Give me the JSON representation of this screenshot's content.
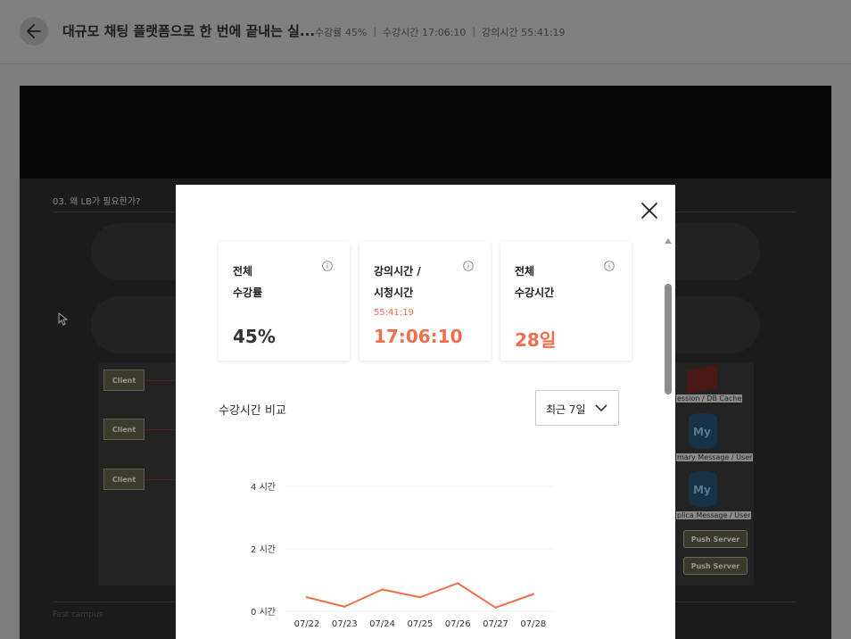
{
  "header": {
    "title": "대규모 채팅 플랫폼으로 한 번에 끝내는 실...",
    "progress": "수강률 45%",
    "watch_time": "수강시간 17:06:10",
    "lecture_time": "강의시간 55:41:19"
  },
  "slide": {
    "title": "03. 왜 LB가 필요한가?",
    "clients": [
      "Client",
      "Client",
      "Client"
    ],
    "labels": [
      "ession / DB Cache",
      "mary Message / User",
      "plica Message / User"
    ],
    "push_servers": [
      "Push Server",
      "Push Server"
    ],
    "db_text": "My",
    "footer": "Fast campus"
  },
  "modal": {
    "cards": [
      {
        "title_line1": "전체",
        "title_line2": "수강률",
        "sub": "",
        "value": "45%",
        "accent": false
      },
      {
        "title_line1": "강의시간 /",
        "title_line2": "시청시간",
        "sub": "55:41:19",
        "value": "17:06:10",
        "accent": true
      },
      {
        "title_line1": "전체",
        "title_line2": "수강시간",
        "sub": "",
        "value": "28일",
        "accent": true
      }
    ],
    "compare_label": "수강시간 비교",
    "range_select": {
      "selected": "최근 7일"
    },
    "accent_color": "#ef6e4c"
  },
  "chart_data": {
    "type": "line",
    "categories": [
      "07/22",
      "07/23",
      "07/24",
      "07/25",
      "07/26",
      "07/27",
      "07/28"
    ],
    "y_ticks": [
      "0 시간",
      "2 시간",
      "4 시간"
    ],
    "ylim": [
      0,
      4
    ],
    "series": [
      {
        "color": "#ef6e4c",
        "values": [
          0.45,
          0.15,
          0.7,
          0.45,
          0.9,
          0.12,
          0.55
        ]
      }
    ],
    "grid": true
  }
}
